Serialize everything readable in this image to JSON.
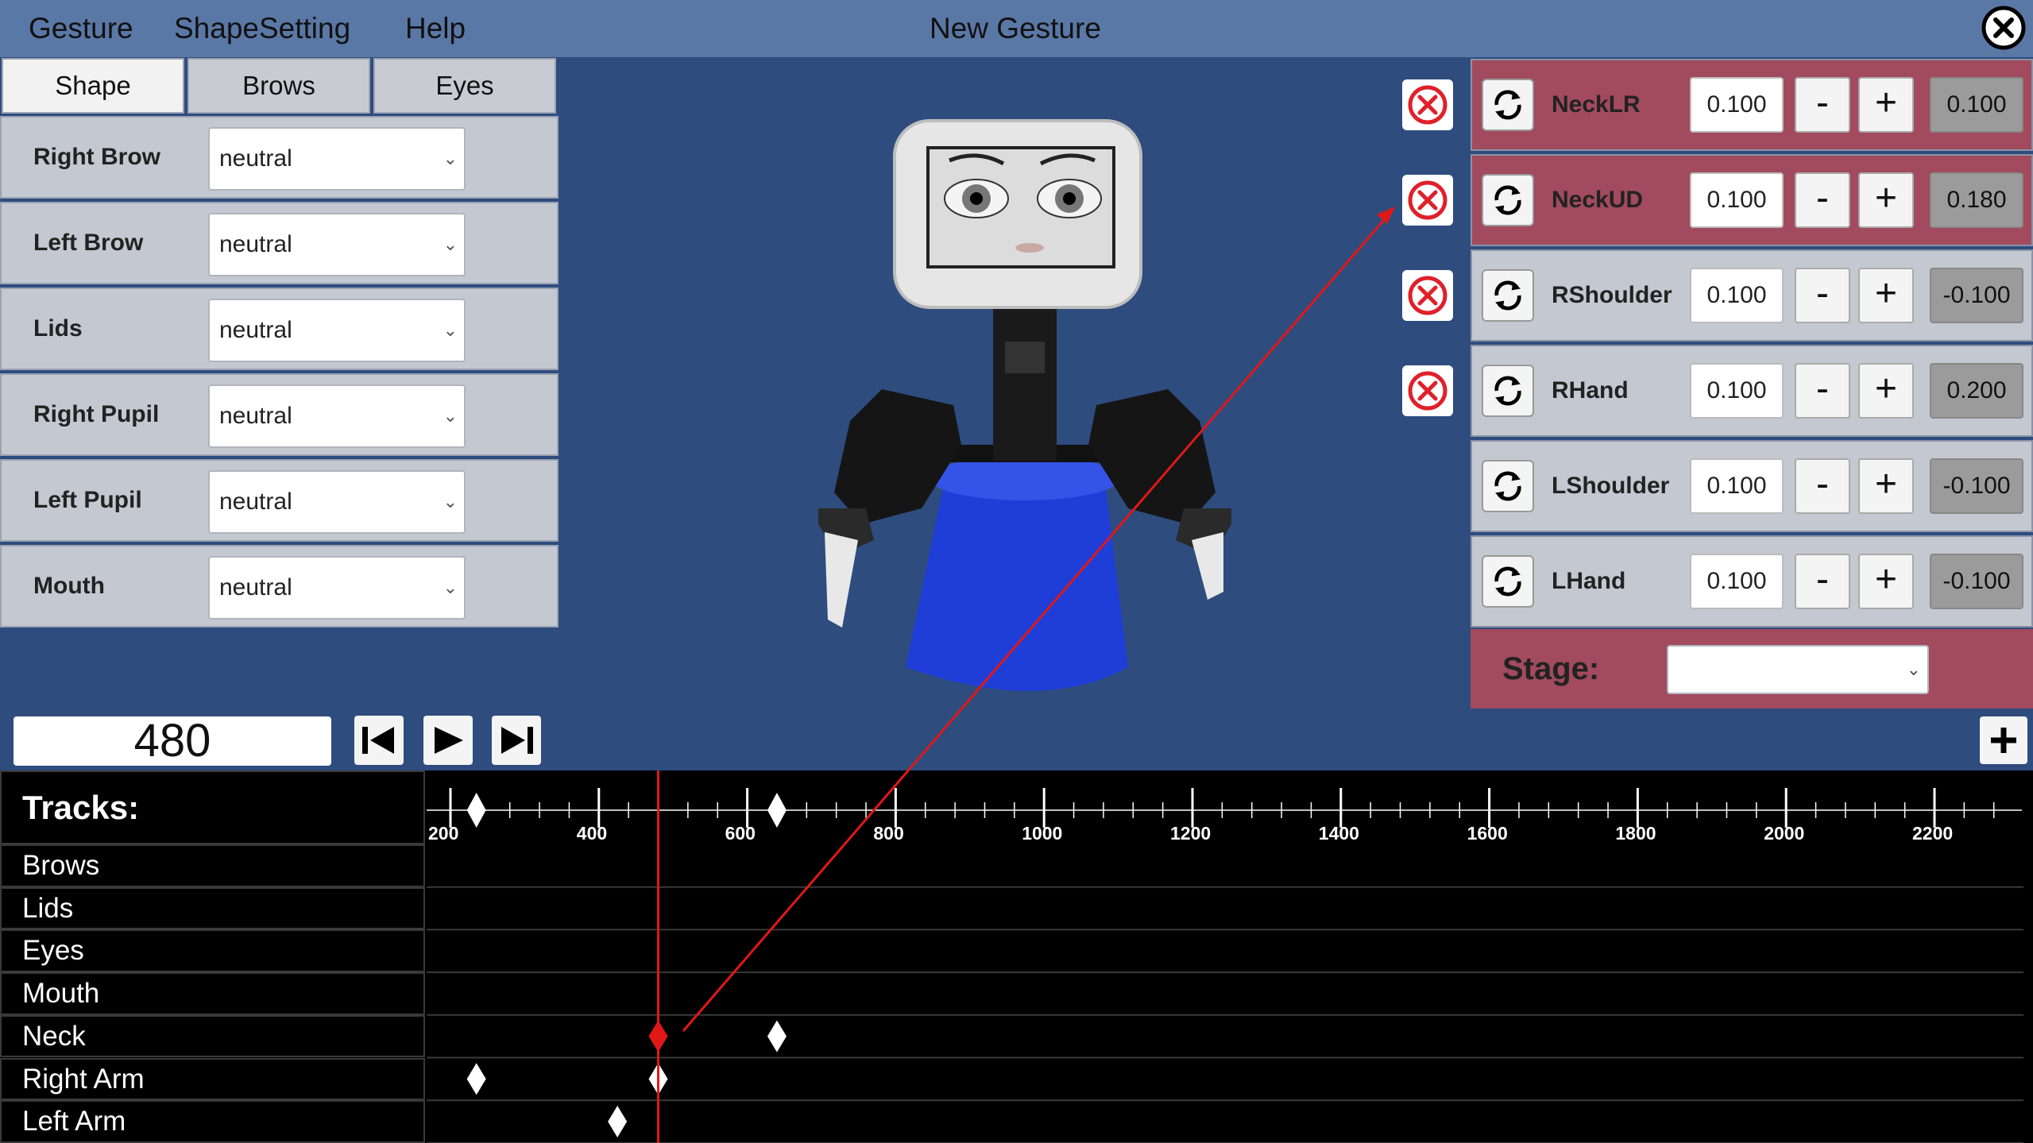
{
  "menu": {
    "items": [
      "Gesture",
      "ShapeSetting",
      "Help"
    ],
    "title": "New Gesture"
  },
  "tabs": [
    "Shape",
    "Brows",
    "Eyes"
  ],
  "shape_rows": [
    {
      "label": "Right Brow",
      "value": "neutral"
    },
    {
      "label": "Left Brow",
      "value": "neutral"
    },
    {
      "label": "Lids",
      "value": "neutral"
    },
    {
      "label": "Right Pupil",
      "value": "neutral"
    },
    {
      "label": "Left Pupil",
      "value": "neutral"
    },
    {
      "label": "Mouth",
      "value": "neutral"
    }
  ],
  "servos": [
    {
      "name": "NeckLR",
      "step": "0.100",
      "value": "0.100",
      "minus": "-",
      "plus": "+",
      "highlighted": true
    },
    {
      "name": "NeckUD",
      "step": "0.100",
      "value": "0.180",
      "minus": "-",
      "plus": "+",
      "highlighted": true
    },
    {
      "name": "RShoulder",
      "step": "0.100",
      "value": "-0.100",
      "minus": "-",
      "plus": "+",
      "highlighted": false
    },
    {
      "name": "RHand",
      "step": "0.100",
      "value": "0.200",
      "minus": "-",
      "plus": "+",
      "highlighted": false
    },
    {
      "name": "LShoulder",
      "step": "0.100",
      "value": "-0.100",
      "minus": "-",
      "plus": "+",
      "highlighted": false
    },
    {
      "name": "LHand",
      "step": "0.100",
      "value": "-0.100",
      "minus": "-",
      "plus": "+",
      "highlighted": false
    }
  ],
  "stage": {
    "label": "Stage:",
    "value": ""
  },
  "transport": {
    "frame": "480"
  },
  "tracks": {
    "header": "Tracks:",
    "names": [
      "Brows",
      "Lids",
      "Eyes",
      "Mouth",
      "Neck",
      "Right Arm",
      "Left Arm"
    ],
    "ruler_labels": [
      "200",
      "400",
      "600",
      "800",
      "1000",
      "1200",
      "1400",
      "1600",
      "1800",
      "2000",
      "2200"
    ],
    "playhead": 480,
    "ruler_keyframes": [
      235,
      640
    ],
    "keyframes": [
      {
        "track": "Neck",
        "frame": 480,
        "selected": true
      },
      {
        "track": "Neck",
        "frame": 640,
        "selected": false
      },
      {
        "track": "Right Arm",
        "frame": 235,
        "selected": false
      },
      {
        "track": "Right Arm",
        "frame": 480,
        "selected": false
      },
      {
        "track": "Left Arm",
        "frame": 425,
        "selected": false
      }
    ]
  },
  "colors": {
    "viewport_bg": "#2e4c7e",
    "menubar": "#5a78a6",
    "highlight_row": "#a24a5e",
    "playhead": "#e01818",
    "delete_icon": "#e0202a"
  }
}
